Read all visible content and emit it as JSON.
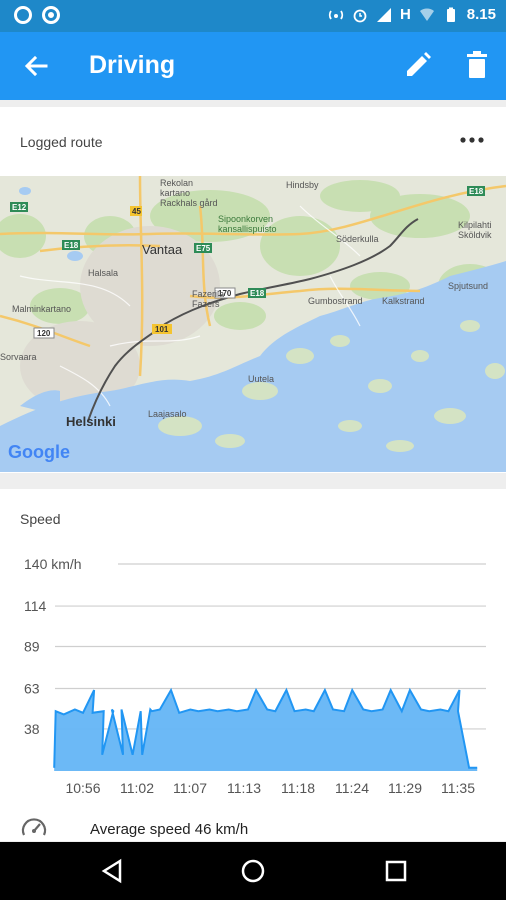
{
  "status_bar": {
    "time": "8.15",
    "network_type": "H"
  },
  "app_bar": {
    "title": "Driving"
  },
  "route_card": {
    "title": "Logged route",
    "map_labels": {
      "rekolan": "Rekolan\nkartano\nRackhals gård",
      "hinosby": "Hindsby",
      "sipoonkorpi": "Sipoonkorven\nkansallispuisto",
      "vantaa": "Vantaa",
      "halsala": "Halsala",
      "malminkartano": "Malminkartano",
      "fazerila": "Fazerila\nFazers",
      "sodkulla": "Söderkulla",
      "kilpilahti": "Kilpilahti\nSköldvik",
      "gumbostrand": "Gumbostrand",
      "kalkstrand": "Kalkstrand",
      "spjutsund": "Spjutsund",
      "sorvaara": "Sorvaara",
      "uutela": "Uutela",
      "helsinki": "Helsinki",
      "laajasalo": "Laajasalo",
      "google": "Google",
      "e12": "E12",
      "e18a": "E18",
      "e18b": "E18",
      "e18c": "E18",
      "r45": "45",
      "e75": "E75",
      "r120": "120",
      "r101": "101",
      "r170": "170"
    }
  },
  "speed_card": {
    "title": "Speed",
    "average_speed": "Average speed 46 km/h"
  },
  "chart_data": {
    "type": "area",
    "title": "Speed",
    "xlabel": "",
    "ylabel": "",
    "y_tick_labels": [
      "140 km/h",
      "114",
      "89",
      "63",
      "38"
    ],
    "y_ticks": [
      140,
      114,
      89,
      63,
      38
    ],
    "x_tick_labels": [
      "10:56",
      "11:02",
      "11:07",
      "11:13",
      "11:18",
      "11:24",
      "11:29",
      "11:35"
    ],
    "ylim": [
      12,
      140
    ],
    "grid": true,
    "color": "#64b5f6",
    "line_color": "#2196f3",
    "series": [
      {
        "x": [
          "10:53",
          "10:53",
          "10:54",
          "10:55",
          "10:56",
          "10:57",
          "10:57",
          "10:58",
          "10:58",
          "10:59",
          "10:59",
          "11:00",
          "11:00",
          "11:01",
          "11:02",
          "11:02",
          "11:03",
          "11:03",
          "11:04",
          "11:05",
          "11:06",
          "11:07",
          "11:08",
          "11:09",
          "11:10",
          "11:11",
          "11:12",
          "11:13",
          "11:14",
          "11:15",
          "11:16",
          "11:17",
          "11:18",
          "11:19",
          "11:20",
          "11:21",
          "11:22",
          "11:23",
          "11:24",
          "11:25",
          "11:26",
          "11:27",
          "11:28",
          "11:29",
          "11:30",
          "11:31",
          "11:32",
          "11:33",
          "11:34",
          "11:35",
          "11:35",
          "11:36",
          "11:37"
        ],
        "values": [
          14,
          49,
          47,
          50,
          48,
          62,
          48,
          49,
          22,
          49,
          50,
          22,
          50,
          22,
          49,
          22,
          50,
          49,
          50,
          62,
          48,
          50,
          49,
          50,
          49,
          50,
          49,
          50,
          62,
          50,
          49,
          62,
          49,
          50,
          49,
          62,
          50,
          49,
          62,
          50,
          49,
          50,
          62,
          49,
          62,
          50,
          49,
          50,
          49,
          62,
          49,
          14,
          14
        ]
      }
    ]
  },
  "colors": {
    "status_bar": "#1e88c9",
    "app_bar": "#2196f3",
    "area_fill": "#64b5f6"
  }
}
